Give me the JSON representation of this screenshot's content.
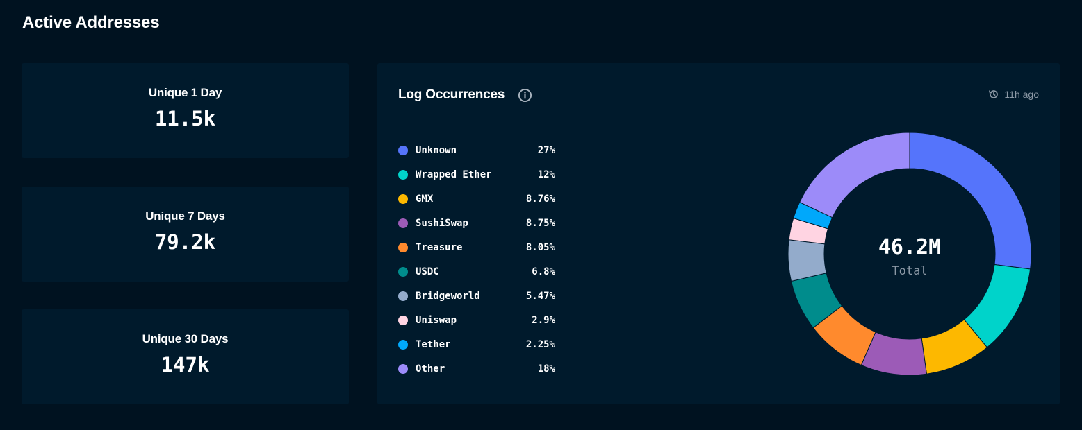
{
  "page": {
    "title": "Active Addresses"
  },
  "stats": [
    {
      "label": "Unique 1 Day",
      "value": "11.5k"
    },
    {
      "label": "Unique 7 Days",
      "value": "79.2k"
    },
    {
      "label": "Unique 30 Days",
      "value": "147k"
    }
  ],
  "log_card": {
    "title": "Log Occurrences",
    "info_icon": "info-icon",
    "updated_icon": "clock-history-icon",
    "updated": "11h ago",
    "total_value": "46.2M",
    "total_label": "Total"
  },
  "legend": [
    {
      "name": "Unknown",
      "pct": "27%",
      "color": "#5574fb"
    },
    {
      "name": "Wrapped Ether",
      "pct": "12%",
      "color": "#00d3ca"
    },
    {
      "name": "GMX",
      "pct": "8.76%",
      "color": "#fdb800"
    },
    {
      "name": "SushiSwap",
      "pct": "8.75%",
      "color": "#9c5bb7"
    },
    {
      "name": "Treasure",
      "pct": "8.05%",
      "color": "#ff8a2d"
    },
    {
      "name": "USDC",
      "pct": "6.8%",
      "color": "#008c8c"
    },
    {
      "name": "Bridgeworld",
      "pct": "5.47%",
      "color": "#93abcb"
    },
    {
      "name": "Uniswap",
      "pct": "2.9%",
      "color": "#ffd4e2"
    },
    {
      "name": "Tether",
      "pct": "2.25%",
      "color": "#00a8fb"
    },
    {
      "name": "Other",
      "pct": "18%",
      "color": "#9c8bf9"
    }
  ],
  "chart_data": {
    "type": "pie",
    "variant": "donut",
    "categories": [
      "Unknown",
      "Wrapped Ether",
      "GMX",
      "SushiSwap",
      "Treasure",
      "USDC",
      "Bridgeworld",
      "Uniswap",
      "Tether",
      "Other"
    ],
    "values": [
      27,
      12,
      8.76,
      8.75,
      8.05,
      6.8,
      5.47,
      2.9,
      2.25,
      18
    ],
    "colors": [
      "#5574fb",
      "#00d3ca",
      "#fdb800",
      "#9c5bb7",
      "#ff8a2d",
      "#008c8c",
      "#93abcb",
      "#ffd4e2",
      "#00a8fb",
      "#9c8bf9"
    ],
    "center_value": "46.2M",
    "center_label": "Total",
    "legend": "left"
  }
}
